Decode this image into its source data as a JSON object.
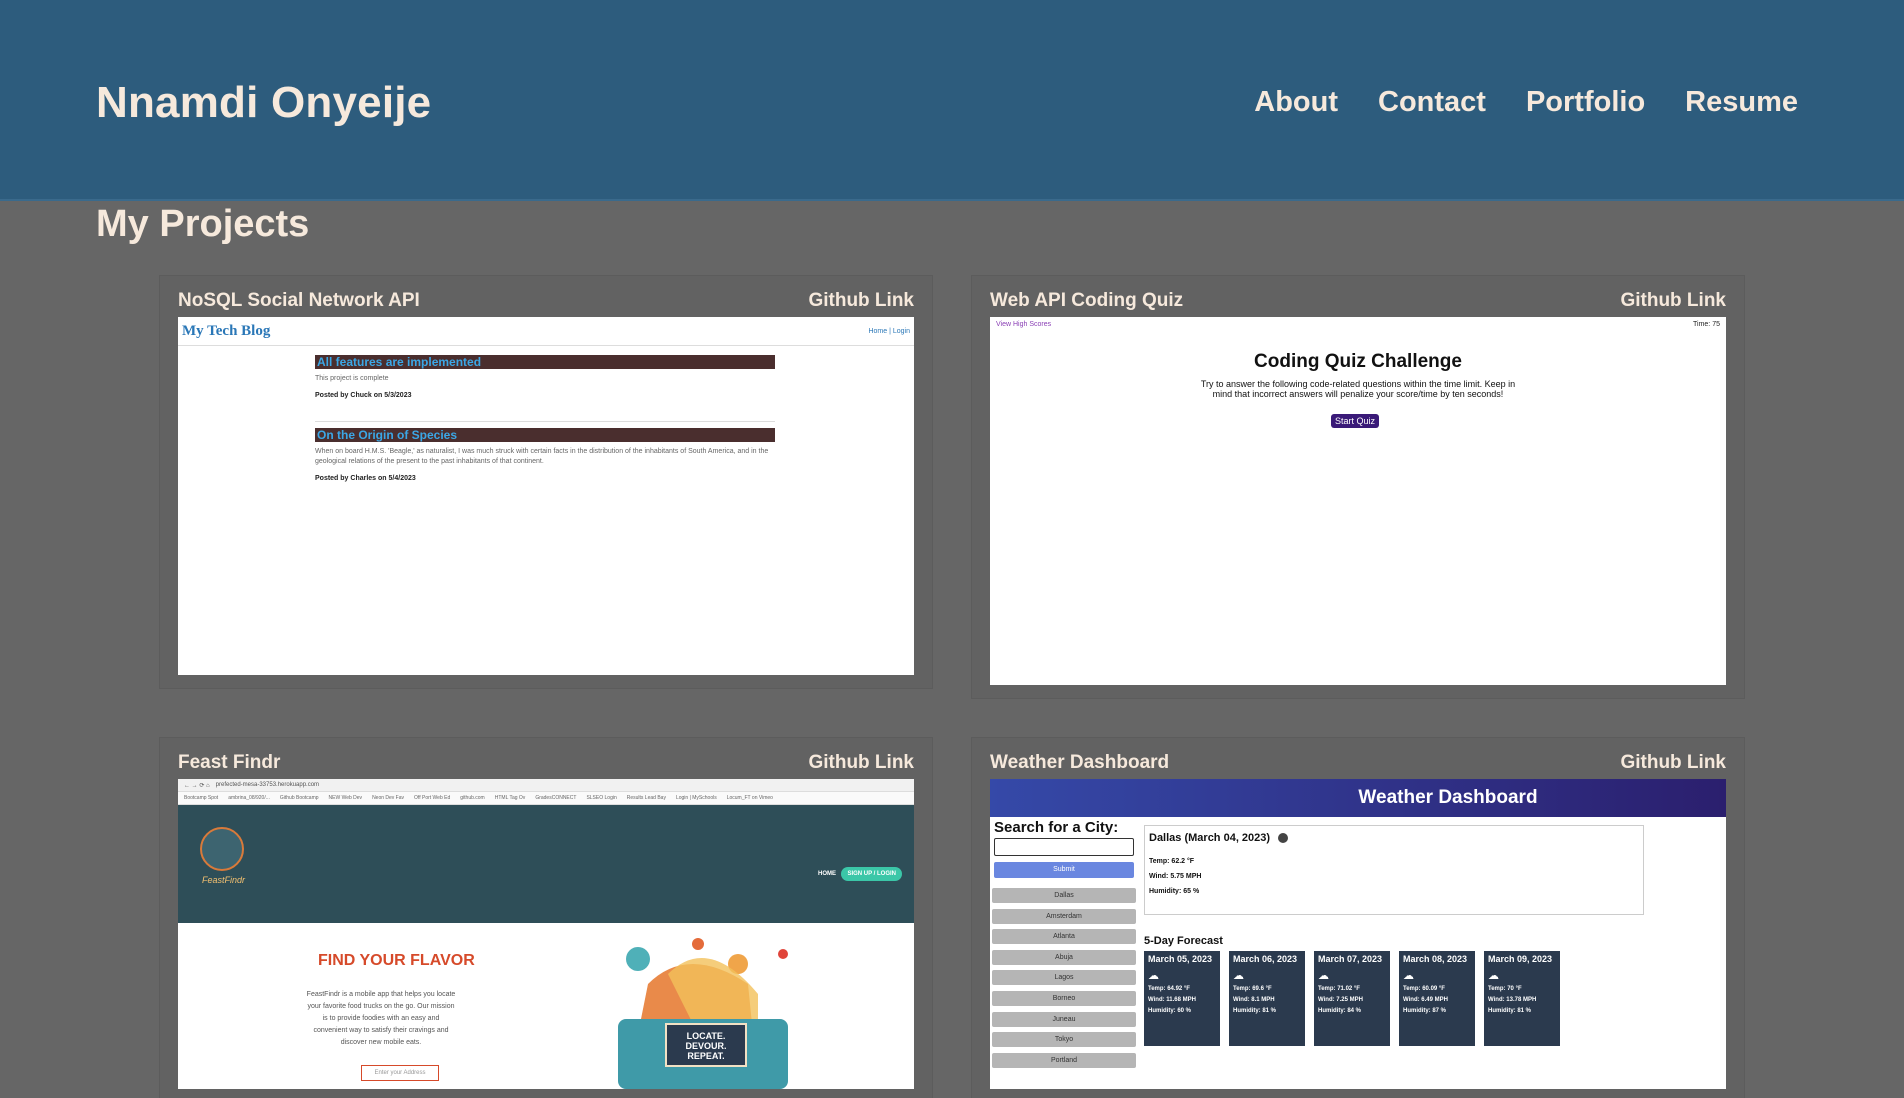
{
  "header": {
    "title": "Nnamdi Onyeije",
    "nav": [
      "About",
      "Contact",
      "Portfolio",
      "Resume"
    ]
  },
  "section_title": "My Projects",
  "projects": [
    {
      "title": "NoSQL Social Network API",
      "link": "Github Link",
      "preview": {
        "blog_name": "My Tech Blog",
        "blog_nav": "Home | Login",
        "posts": [
          {
            "title": "All features are implemented",
            "body": "This project is complete",
            "meta": "Posted by Chuck on 5/3/2023"
          },
          {
            "title": "On the Origin of Species",
            "body": "When on board H.M.S. 'Beagle,' as naturalist, I was much struck with certain facts in the distribution of the inhabitants of South America, and in the geological relations of the present to the past inhabitants of that continent.",
            "meta": "Posted by Charles on 5/4/2023"
          }
        ]
      }
    },
    {
      "title": "Web API Coding Quiz",
      "link": "Github Link",
      "preview": {
        "high_scores": "View High Scores",
        "time": "Time: 75",
        "heading": "Coding Quiz Challenge",
        "text": "Try to answer the following code-related questions within the time limit. Keep in mind that incorrect answers will penalize your score/time by ten seconds!",
        "button": "Start Quiz"
      }
    },
    {
      "title": "Feast Findr",
      "link": "Github Link",
      "preview": {
        "url": "prefected-mesa-33753.herokuapp.com",
        "bookmarks": [
          "Bootcamp Spot",
          "ambrina_08/920/...",
          "Github Bootcamp",
          "NEW Web Dev",
          "Neon Dev Fav",
          "Off Port Web Ed",
          "github.com",
          "HTML Tag Ov",
          "GradesCONNECT",
          "SLSEO Login",
          "Results Lead Bay",
          "Login | MySchools",
          "Locum_FT on Vimeo"
        ],
        "logo_text": "FeastFindr",
        "home": "HOME",
        "signup": "SIGN UP / LOGIN",
        "flavor": "FIND YOUR FLAVOR",
        "description": "FeastFindr is a mobile app that helps you locate your favorite food trucks on the go. Our mission is to provide foodies with an easy and convenient way to satisfy their cravings and discover new mobile eats.",
        "address_placeholder": "Enter your Address",
        "truck_sign": "LOCATE. DEVOUR. REPEAT."
      }
    },
    {
      "title": "Weather Dashboard",
      "link": "Github Link",
      "preview": {
        "banner": "Weather Dashboard",
        "search_label": "Search for a City:",
        "submit": "Submit",
        "cities": [
          "Dallas",
          "Amsterdam",
          "Atlanta",
          "Abuja",
          "Lagos",
          "Borneo",
          "Juneau",
          "Tokyo",
          "Portland"
        ],
        "current": {
          "heading": "Dallas (March 04, 2023)",
          "temp": "Temp: 62.2 °F",
          "wind": "Wind: 5.75 MPH",
          "humidity": "Humidity: 65 %"
        },
        "forecast_title": "5-Day Forecast",
        "forecast": [
          {
            "date": "March 05, 2023",
            "temp": "Temp: 64.92 °F",
            "wind": "Wind: 11.68 MPH",
            "humidity": "Humidity: 60 %"
          },
          {
            "date": "March 06, 2023",
            "temp": "Temp: 69.6 °F",
            "wind": "Wind: 8.1 MPH",
            "humidity": "Humidity: 81 %"
          },
          {
            "date": "March 07, 2023",
            "temp": "Temp: 71.02 °F",
            "wind": "Wind: 7.25 MPH",
            "humidity": "Humidity: 84 %"
          },
          {
            "date": "March 08, 2023",
            "temp": "Temp: 60.09 °F",
            "wind": "Wind: 6.49 MPH",
            "humidity": "Humidity: 87 %"
          },
          {
            "date": "March 09, 2023",
            "temp": "Temp: 70 °F",
            "wind": "Wind: 13.78 MPH",
            "humidity": "Humidity: 81 %"
          }
        ]
      }
    }
  ]
}
